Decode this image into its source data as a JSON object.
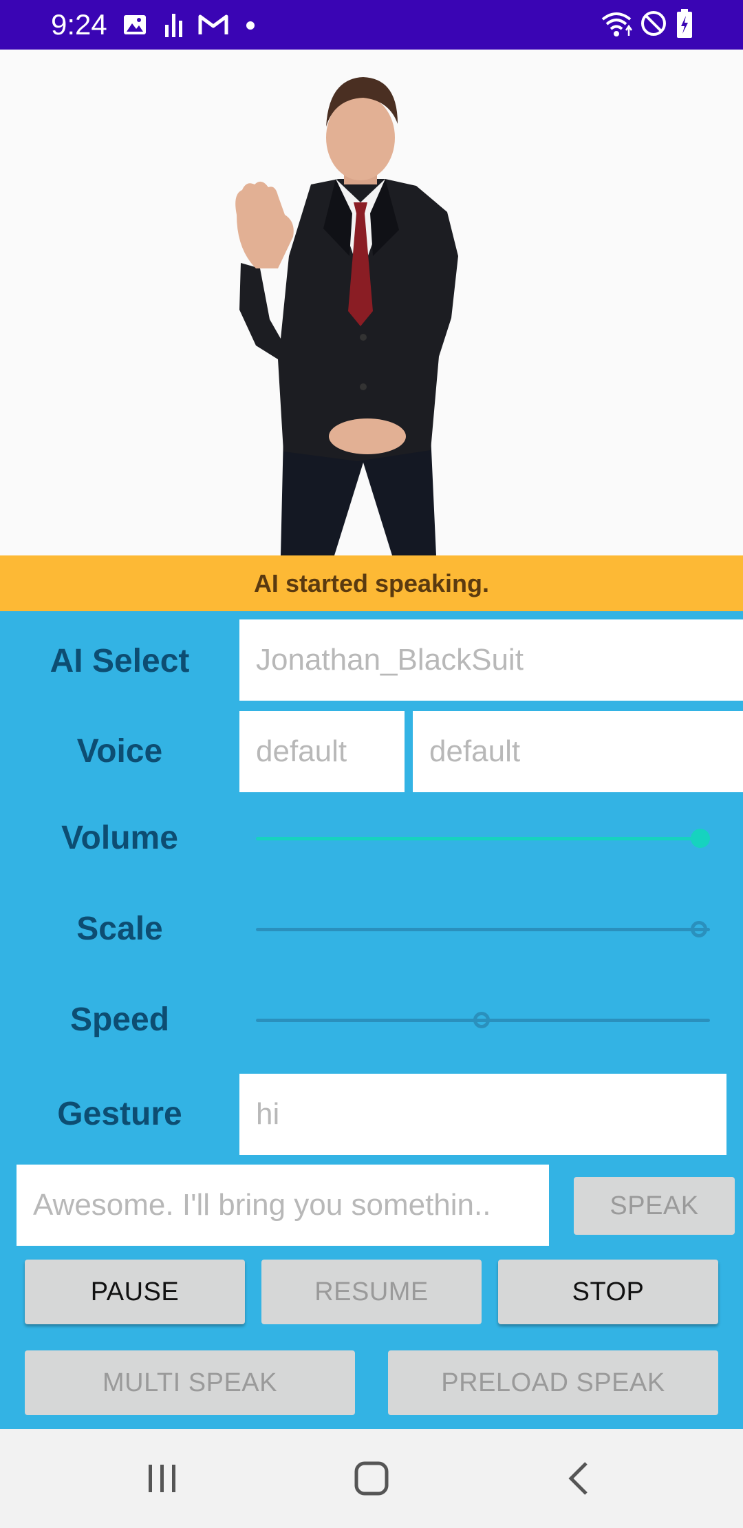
{
  "status_bar": {
    "time": "9:24",
    "icons": [
      "image-icon",
      "signal-bars-icon",
      "gmail-icon",
      "dot-icon",
      "wifi-icon",
      "do-not-disturb-icon",
      "battery-charging-icon"
    ]
  },
  "banner": {
    "text": "AI started speaking."
  },
  "form": {
    "ai_select": {
      "label": "AI Select",
      "value": "Jonathan_BlackSuit"
    },
    "voice": {
      "label": "Voice",
      "value_1": "default",
      "value_2": "default"
    },
    "volume": {
      "label": "Volume",
      "level": 1.0
    },
    "scale": {
      "label": "Scale",
      "level": 1.0
    },
    "speed": {
      "label": "Speed",
      "level": 0.5
    },
    "gesture": {
      "label": "Gesture",
      "value": "hi"
    }
  },
  "speak_input": {
    "value": "Awesome. I'll bring you somethin.."
  },
  "buttons": {
    "speak": "SPEAK",
    "pause": "PAUSE",
    "resume": "RESUME",
    "stop": "STOP",
    "multi_speak": "MULTI SPEAK",
    "preload_speak": "PRELOAD SPEAK"
  },
  "colors": {
    "status_bar": "#3a05b4",
    "banner": "#fdb935",
    "panel": "#33b3e4",
    "accent_slider": "#16d3bf"
  }
}
